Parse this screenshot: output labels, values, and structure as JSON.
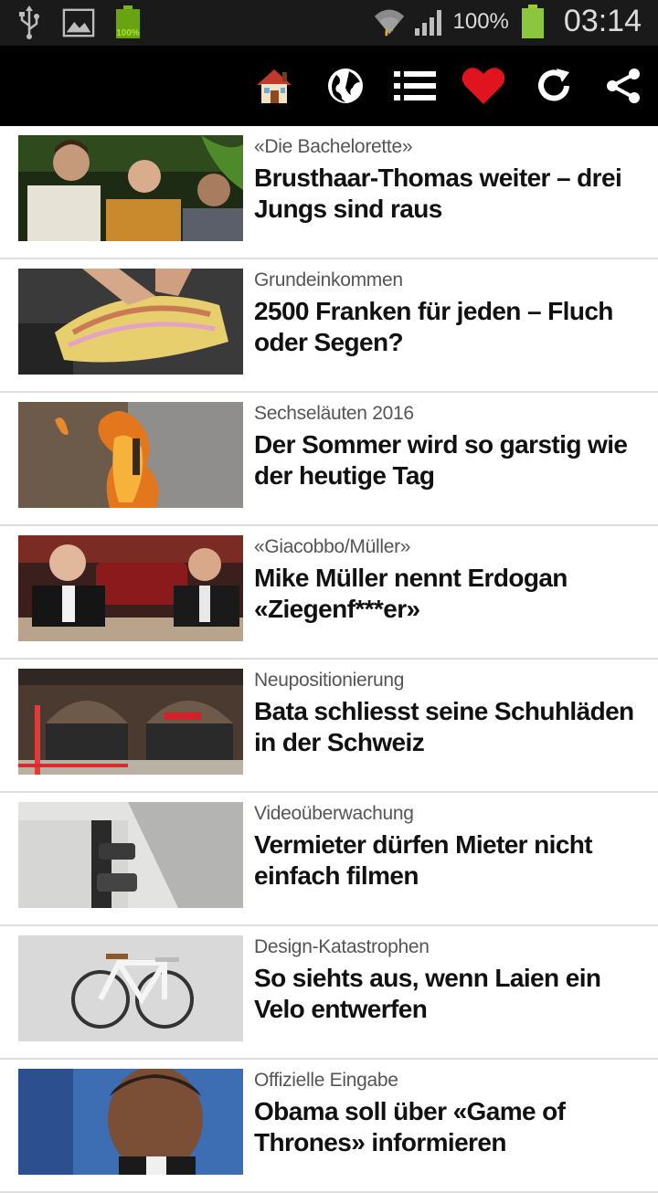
{
  "status_bar": {
    "battery_percent": "100%",
    "small_battery_label": "100%",
    "time": "03:14"
  },
  "toolbar": {
    "icons": [
      "home-icon",
      "globe-icon",
      "list-icon",
      "heart-icon",
      "refresh-icon",
      "share-icon"
    ],
    "heart_color": "#e0141e"
  },
  "articles": [
    {
      "kicker": "«Die Bachelorette»",
      "headline": "Brusthaar-Thomas weiter – drei Jungs sind raus"
    },
    {
      "kicker": "Grundeinkommen",
      "headline": "2500 Franken für jeden – Fluch oder Segen?"
    },
    {
      "kicker": "Sechseläuten 2016",
      "headline": "Der Sommer wird so garstig wie der heutige Tag"
    },
    {
      "kicker": "«Giacobbo/Müller»",
      "headline": "Mike Müller nennt Erdogan «Ziegenf***er»"
    },
    {
      "kicker": "Neupositionierung",
      "headline": "Bata schliesst seine Schuhläden in der Schweiz"
    },
    {
      "kicker": "Videoüberwachung",
      "headline": "Vermieter dürfen Mieter nicht einfach filmen"
    },
    {
      "kicker": "Design-Katastrophen",
      "headline": "So siehts aus, wenn Laien ein Velo entwerfen"
    },
    {
      "kicker": "Offizielle Eingabe",
      "headline": "Obama soll über «Game of Thrones» informieren"
    }
  ]
}
